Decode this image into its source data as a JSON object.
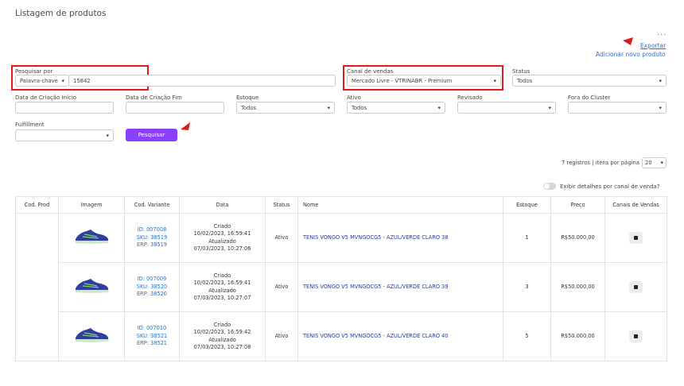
{
  "page": {
    "title": "Listagem de produtos",
    "more": "..."
  },
  "actions": {
    "export": "Exportar",
    "add_product": "Adicionar novo produto"
  },
  "filters": {
    "search_by": {
      "label": "Pesquisar por",
      "type_value": "Palavra-chave",
      "value": "15842"
    },
    "sales_channel": {
      "label": "Canal de vendas",
      "value": "Mercado Livre - VTRINABR - Premium"
    },
    "status": {
      "label": "Status",
      "value": "Todos"
    },
    "created_start": {
      "label": "Data de Criação Início",
      "value": ""
    },
    "created_end": {
      "label": "Data de Criação Fim",
      "value": ""
    },
    "stock": {
      "label": "Estoque",
      "value": "Todos"
    },
    "active": {
      "label": "Ativo",
      "value": "Todos"
    },
    "reviewed": {
      "label": "Revisado",
      "value": ""
    },
    "out_of_cluster": {
      "label": "Fora do Cluster",
      "value": ""
    },
    "fulfillment": {
      "label": "Fulfillment",
      "value": ""
    },
    "search_button": "Pesquisar"
  },
  "pagination": {
    "summary": "7 registros | itens por página",
    "per_page": "20"
  },
  "channel_toggle": {
    "label": "Exibir detalhes por canal de venda?"
  },
  "table": {
    "headers": [
      "Cod. Prod",
      "Imagem",
      "Cod. Variante",
      "Data",
      "Status",
      "Nome",
      "Estoque",
      "Preço",
      "Canais de Vendas"
    ],
    "rows": [
      {
        "id": "ID: 007008",
        "sku": "SKU: 38519",
        "erp": "ERP: 38519",
        "created": "Criado",
        "created_at": "10/02/2023, 16:59:41",
        "updated": "Atualizado",
        "updated_at": "07/03/2023, 10:27:06",
        "status": "Ativo",
        "name": "TENIS VONGO V5 MVNGOCG5 - AZUL/VERDE CLARO 38",
        "stock": "1",
        "price": "R$50.000,00"
      },
      {
        "id": "ID: 007009",
        "sku": "SKU: 38520",
        "erp": "ERP: 38520",
        "created": "Criado",
        "created_at": "10/02/2023, 16:59:41",
        "updated": "Atualizado",
        "updated_at": "07/03/2023, 10:27:07",
        "status": "Ativo",
        "name": "TENIS VONGO V5 MVNGOCG5 - AZUL/VERDE CLARO 39",
        "stock": "3",
        "price": "R$50.000,00"
      },
      {
        "id": "ID: 007010",
        "sku": "SKU: 38521",
        "erp": "ERP: 38521",
        "created": "Criado",
        "created_at": "10/02/2023, 16:59:42",
        "updated": "Atualizado",
        "updated_at": "07/03/2023, 10:27:08",
        "status": "Ativo",
        "name": "TENIS VONGO V5 MVNGOCG5 - AZUL/VERDE CLARO 40",
        "stock": "5",
        "price": "R$50.000,00"
      }
    ]
  },
  "colors": {
    "accent": "#8a3ffc",
    "link": "#2a6fc9",
    "highlight": "#e01b1b"
  },
  "icons": {
    "row_image": "running-shoe-icon",
    "channel": "marketplace-icon",
    "more": "more-icon"
  }
}
